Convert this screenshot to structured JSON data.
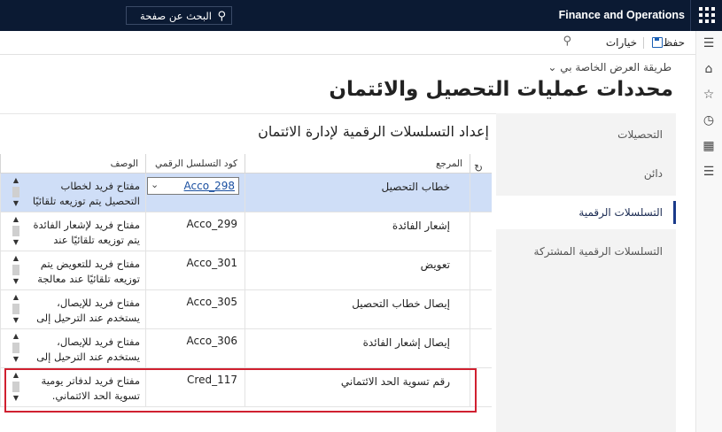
{
  "topbar": {
    "app_name": "Finance and Operations",
    "search_text": "البحث عن صفحة"
  },
  "actionbar": {
    "save_label": "حفظ",
    "options_label": "خيارات"
  },
  "header": {
    "view_switch": "طريقة العرض الخاصة بي",
    "title": "محددات عمليات التحصيل والائتمان"
  },
  "panel": {
    "items": [
      {
        "label": "التحصيلات"
      },
      {
        "label": "دائن"
      },
      {
        "label": "التسلسلات الرقمية"
      },
      {
        "label": "التسلسلات الرقمية المشتركة"
      }
    ]
  },
  "section": {
    "title": "إعداد التسلسلات الرقمية لإدارة الائتمان"
  },
  "grid": {
    "col_reference": "المرجع",
    "col_code": "كود التسلسل الرقمي",
    "col_description": "الوصف",
    "rows": [
      {
        "reference": "خطاب التحصيل",
        "code": "Acco_298",
        "description": "مفتاح فريد لخطاب التحصيل يتم توزيعه تلقائيًا"
      },
      {
        "reference": "إشعار الفائدة",
        "code": "Acco_299",
        "description": "مفتاح فريد لإشعار الفائدة يتم توزيعه تلقائيًا عند"
      },
      {
        "reference": "تعويض",
        "code": "Acco_301",
        "description": "مفتاح فريد للتعويض يتم توزيعه تلقائيًا عند معالجة"
      },
      {
        "reference": "إيصال خطاب التحصيل",
        "code": "Acco_305",
        "description": "مفتاح فريد للإيصال، يستخدم عند الترحيل إلى"
      },
      {
        "reference": "إيصال إشعار الفائدة",
        "code": "Acco_306",
        "description": "مفتاح فريد للإيصال، يستخدم عند الترحيل إلى"
      },
      {
        "reference": "رقم تسوية الحد الائتماني",
        "code": "Cred_117",
        "description": "مفتاح فريد لدفاتر يومية تسوية الحد الائتماني."
      }
    ]
  }
}
